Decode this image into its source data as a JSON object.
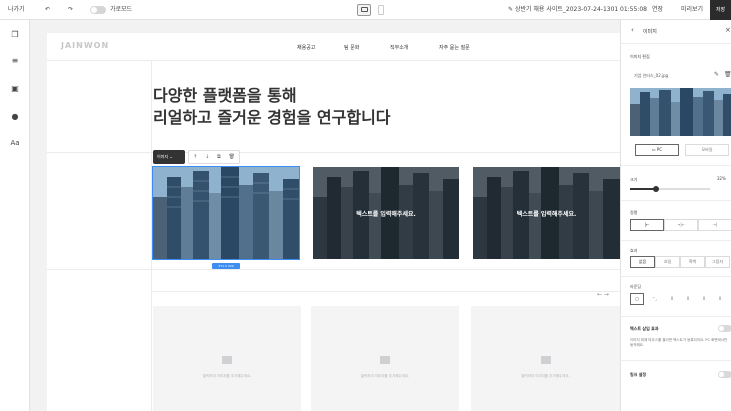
{
  "topbar": {
    "exit_label": "나가기",
    "toggle_label": "가로모드",
    "filename": "상반기 채용 사이트_2023-07-24-1301",
    "time": "01:55:08",
    "save_temp_label": "연장",
    "preview_label": "미리보기",
    "save_label": "저장"
  },
  "site": {
    "logo": "JAINWON",
    "nav": [
      "채용공고",
      "팀 문화",
      "직무소개",
      "자주 묻는 질문"
    ]
  },
  "canvas": {
    "heading_line1": "다양한 플랫폼을 통해",
    "heading_line2": "리얼하고 즐거운 경험을 연구합니다",
    "selection_type": "이미지",
    "size_badge": "371 X 229",
    "caption_2": "텍스트를 입력해주세요.",
    "caption_3": "텍스트를 입력해주세요.",
    "placeholder_text": "클릭하여 이미지를 추가해주세요."
  },
  "panel": {
    "title": "이미지",
    "image_edit_label": "이미지 편집",
    "file_name": "기업 인터스_02.jpg",
    "device_pc": "PC",
    "device_mo": "모바일",
    "size_label": "크기",
    "size_value": "32%",
    "size_fraction": 0.32,
    "align_label": "정렬",
    "effect_label": "효과",
    "effect_options": [
      "없음",
      "흐림",
      "흑백",
      "그림자"
    ],
    "radius_label": "라운딩",
    "radius_values": [
      "0",
      "0",
      "0",
      "0"
    ],
    "text_effect_label": "텍스트 삽입 효과",
    "text_effect_desc": "이미지 위에 마우스를 올리면 텍스트가 등록되어요. PC 화면에서만 동작해요.",
    "link_label": "링크 설정"
  },
  "colors": {
    "accent": "#3d8ef0",
    "dark": "#2b2b2b"
  }
}
